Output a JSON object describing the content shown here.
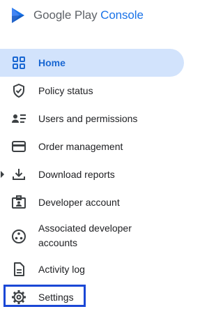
{
  "brand": {
    "google_play": "Google Play",
    "console": "Console"
  },
  "nav": {
    "items": [
      {
        "label": "Home",
        "icon": "grid-icon",
        "active": true
      },
      {
        "label": "Policy status",
        "icon": "shield-check-icon"
      },
      {
        "label": "Users and permissions",
        "icon": "users-list-icon"
      },
      {
        "label": "Order management",
        "icon": "credit-card-icon"
      },
      {
        "label": "Download reports",
        "icon": "download-icon",
        "expandable": true
      },
      {
        "label": "Developer account",
        "icon": "id-badge-icon"
      },
      {
        "label": "Associated developer accounts",
        "label_line1": "Associated developer",
        "label_line2": "accounts",
        "icon": "linked-accounts-icon"
      },
      {
        "label": "Activity log",
        "icon": "document-icon"
      },
      {
        "label": "Settings",
        "icon": "gear-icon",
        "highlighted": true
      }
    ]
  },
  "colors": {
    "active_bg": "#d2e3fc",
    "active_text": "#1967d2",
    "accent": "#1a73e8",
    "highlight_border": "#1a47d6"
  }
}
